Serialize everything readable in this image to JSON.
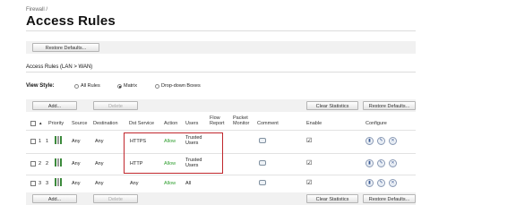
{
  "breadcrumb": "Firewall /",
  "title": "Access Rules",
  "restore_defaults_top": "Restore Defaults...",
  "section_label": "Access Rules (LAN > WAN)",
  "view_style": {
    "label": "View Style:",
    "options": [
      "All Rules",
      "Matrix",
      "Drop-down Boxes"
    ],
    "selected": "Matrix"
  },
  "toolbar": {
    "add": "Add...",
    "delete": "Delete",
    "clear_statistics": "Clear Statistics",
    "restore_defaults": "Restore Defaults..."
  },
  "columns": {
    "sort_arrow": "▲",
    "priority": "Priority",
    "source": "Source",
    "destination": "Destination",
    "dst_service": "Dst Service",
    "action": "Action",
    "users": "Users",
    "flow_report": "Flow Report",
    "packet_monitor": "Packet Monitor",
    "comment": "Comment",
    "enable": "Enable",
    "configure": "Configure"
  },
  "rows": [
    {
      "num": "1",
      "prio": "1",
      "source": "Any",
      "destination": "Any",
      "service": "HTTPS",
      "action": "Allow",
      "users": "Trusted Users",
      "enabled": "☑"
    },
    {
      "num": "2",
      "prio": "2",
      "source": "Any",
      "destination": "Any",
      "service": "HTTP",
      "action": "Allow",
      "users": "Trusted Users",
      "enabled": "☑"
    },
    {
      "num": "3",
      "prio": "3",
      "source": "Any",
      "destination": "Any",
      "service": "Any",
      "action": "Allow",
      "users": "All",
      "enabled": "☑"
    }
  ],
  "colors": {
    "allow": "#2e9e2e",
    "highlight": "#c0262c"
  }
}
